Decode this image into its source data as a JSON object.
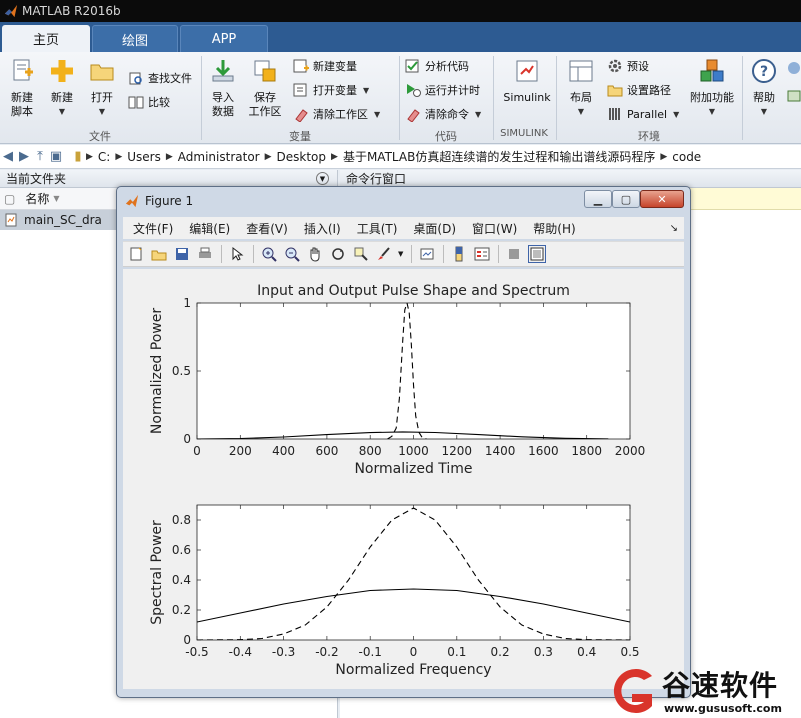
{
  "window": {
    "title": "MATLAB R2016b"
  },
  "tabs": [
    {
      "label": "主页",
      "active": true
    },
    {
      "label": "绘图",
      "active": false
    },
    {
      "label": "APP",
      "active": false
    }
  ],
  "ribbon": {
    "file_group": {
      "label": "文件",
      "new_script": "新建\n脚本",
      "new": "新建",
      "open": "打开",
      "find_files": "查找文件",
      "compare": "比较"
    },
    "variable_group": {
      "label": "变量",
      "import_data": "导入\n数据",
      "save_workspace": "保存\n工作区",
      "new_variable": "新建变量",
      "open_variable": "打开变量",
      "clear_workspace": "清除工作区"
    },
    "code_group": {
      "label": "代码",
      "analyze_code": "分析代码",
      "run_and_time": "运行并计时",
      "clear_commands": "清除命令"
    },
    "simulink_group": {
      "label": "SIMULINK",
      "simulink": "Simulink"
    },
    "environment_group": {
      "label": "环境",
      "layout": "布局",
      "preferences": "预设",
      "set_path": "设置路径",
      "parallel": "Parallel",
      "addons": "附加功能"
    },
    "resources_group": {
      "help": "帮助"
    }
  },
  "address": {
    "path": [
      "C:",
      "Users",
      "Administrator",
      "Desktop",
      "基于MATLAB仿真超连续谱的发生过程和输出谱线源码程序",
      "code"
    ]
  },
  "left_panel": {
    "title": "当前文件夹",
    "column_name": "名称",
    "files": [
      "main_SC_dra"
    ]
  },
  "right_panel": {
    "title": "命令行窗口"
  },
  "figure": {
    "title": "Figure 1",
    "menu": [
      "文件(F)",
      "编辑(E)",
      "查看(V)",
      "插入(I)",
      "工具(T)",
      "桌面(D)",
      "窗口(W)",
      "帮助(H)"
    ]
  },
  "chart_data": [
    {
      "type": "line",
      "title": "Input and Output Pulse Shape and Spectrum",
      "xlabel": "Normalized Time",
      "ylabel": "Normalized Power",
      "xlim": [
        0,
        2000
      ],
      "ylim": [
        0,
        1
      ],
      "xticks": [
        0,
        200,
        400,
        600,
        800,
        1000,
        1200,
        1400,
        1600,
        1800,
        2000
      ],
      "yticks": [
        0,
        0.5,
        1
      ],
      "grid": false,
      "series": [
        {
          "style": "solid",
          "color": "#000000",
          "x": [
            0,
            200,
            400,
            600,
            800,
            950,
            1100,
            1300,
            1500,
            1700,
            1900
          ],
          "y": [
            0.0,
            0.004,
            0.015,
            0.032,
            0.047,
            0.052,
            0.048,
            0.032,
            0.016,
            0.005,
            0.001
          ]
        },
        {
          "style": "dashed",
          "color": "#000000",
          "x": [
            880,
            900,
            920,
            935,
            950,
            960,
            970,
            980,
            990,
            1000,
            1010,
            1025,
            1040,
            1060
          ],
          "y": [
            0.0,
            0.02,
            0.08,
            0.3,
            0.72,
            0.95,
            1.0,
            0.93,
            0.7,
            0.4,
            0.17,
            0.05,
            0.01,
            0.0
          ]
        }
      ]
    },
    {
      "type": "line",
      "xlabel": "Normalized Frequency",
      "ylabel": "Spectral Power",
      "xlim": [
        -0.5,
        0.5
      ],
      "ylim": [
        0,
        0.9
      ],
      "xticks": [
        -0.5,
        -0.4,
        -0.3,
        -0.2,
        -0.1,
        0,
        0.1,
        0.2,
        0.3,
        0.4,
        0.5
      ],
      "yticks": [
        0,
        0.2,
        0.4,
        0.6,
        0.8
      ],
      "grid": false,
      "series": [
        {
          "style": "solid",
          "color": "#000000",
          "x": [
            -0.5,
            -0.4,
            -0.3,
            -0.2,
            -0.1,
            0,
            0.1,
            0.2,
            0.3,
            0.4,
            0.5
          ],
          "y": [
            0.12,
            0.18,
            0.24,
            0.29,
            0.33,
            0.34,
            0.33,
            0.29,
            0.24,
            0.18,
            0.12
          ]
        },
        {
          "style": "dashed",
          "color": "#000000",
          "x": [
            -0.5,
            -0.4,
            -0.35,
            -0.3,
            -0.25,
            -0.2,
            -0.15,
            -0.1,
            -0.05,
            0,
            0.05,
            0.1,
            0.15,
            0.2,
            0.25,
            0.3,
            0.35,
            0.4,
            0.5
          ],
          "y": [
            0.0,
            0.002,
            0.01,
            0.04,
            0.1,
            0.22,
            0.4,
            0.62,
            0.8,
            0.88,
            0.8,
            0.62,
            0.4,
            0.22,
            0.1,
            0.04,
            0.01,
            0.002,
            0.0
          ]
        }
      ]
    }
  ],
  "watermark": {
    "name": "谷速软件",
    "url": "www.gususoft.com",
    "color": "#d9342b"
  },
  "colors": {
    "titlebar": "#0b0b0b",
    "tabbar": "#2d5b92",
    "ribbon": "#eef2f7",
    "figure_bg": "#f0f0f0"
  }
}
